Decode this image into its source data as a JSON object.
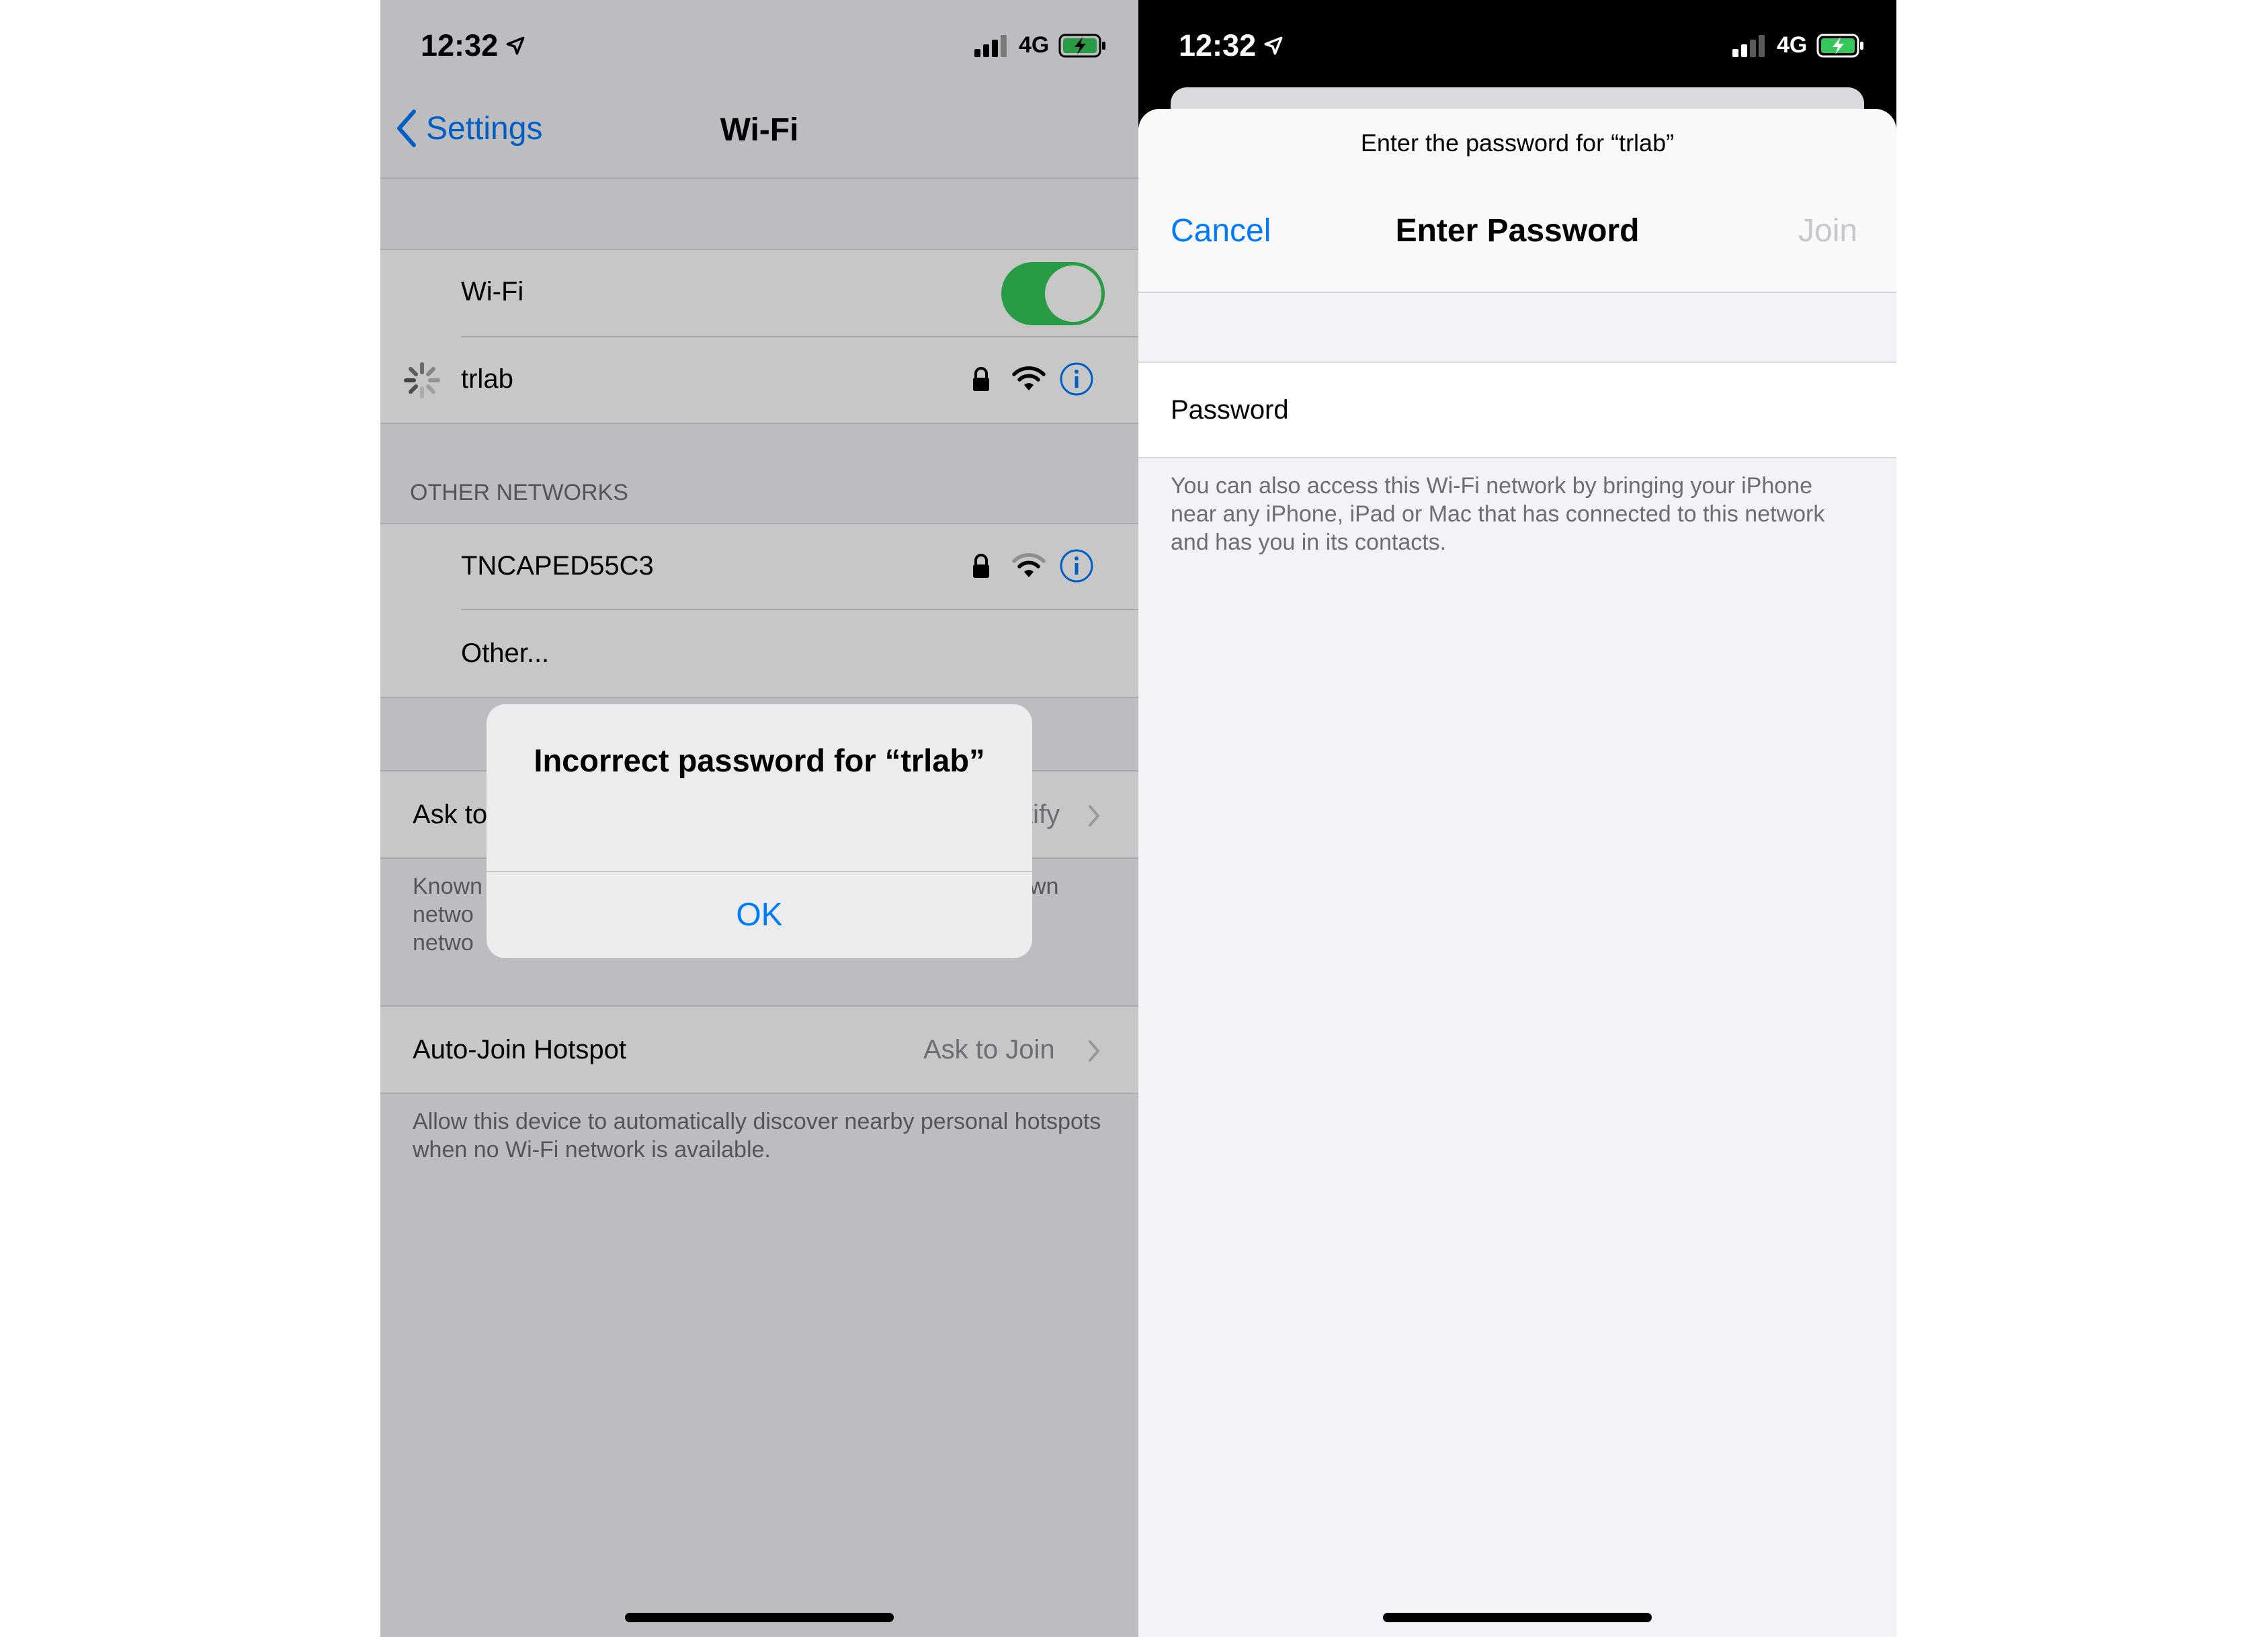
{
  "left": {
    "status": {
      "time": "12:32",
      "network": "4G"
    },
    "nav": {
      "back_label": "Settings",
      "title": "Wi-Fi"
    },
    "wifi_toggle": {
      "label": "Wi-Fi"
    },
    "current_network": {
      "name": "trlab"
    },
    "other_networks": {
      "header": "OTHER NETWORKS",
      "items": [
        {
          "name": "TNCAPED55C3"
        },
        {
          "name": "Other..."
        }
      ]
    },
    "ask_to_join": {
      "label_visible": "Ask to",
      "value_visible": "tify",
      "footer_left": [
        "Known",
        "netwo",
        "netwo"
      ],
      "footer_right": "wn"
    },
    "auto_join": {
      "label": "Auto-Join Hotspot",
      "value": "Ask to Join",
      "footer": "Allow this device to automatically discover nearby personal hotspots when no Wi-Fi network is available."
    },
    "alert": {
      "title": "Incorrect password for “trlab”",
      "ok_label": "OK"
    }
  },
  "right": {
    "status": {
      "time": "12:32",
      "network": "4G"
    },
    "sheet": {
      "prompt": "Enter the password for “trlab”",
      "cancel_label": "Cancel",
      "title": "Enter Password",
      "join_label": "Join",
      "password_label": "Password",
      "info_text": "You can also access this Wi-Fi network by bringing your iPhone near any iPhone, iPad or Mac that has connected to this network and has you in its contacts."
    }
  },
  "colors": {
    "accent": "#007aff",
    "toggle_on": "#34c759",
    "battery_charging": "#34c759"
  }
}
